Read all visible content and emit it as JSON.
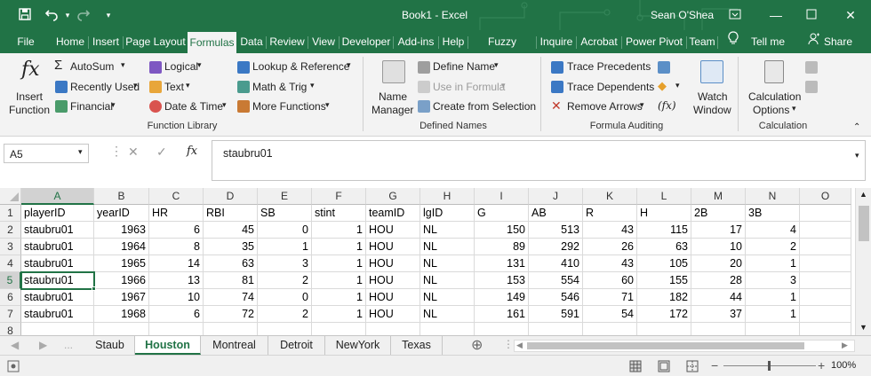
{
  "titlebar": {
    "doc_title": "Book1 - Excel",
    "user": "Sean O'Shea",
    "qat": {
      "save": "save-icon",
      "undo": "undo-icon",
      "redo": "redo-icon",
      "customize": "customize-icon"
    }
  },
  "tabs": [
    "File",
    "Home",
    "Insert",
    "Page Layout",
    "Formulas",
    "Data",
    "Review",
    "View",
    "Developer",
    "Add-ins",
    "Help",
    "Fuzzy Lookup",
    "Inquire",
    "Acrobat",
    "Power Pivot",
    "Team"
  ],
  "selected_tab": "Formulas",
  "tellme": "Tell me",
  "share": "Share",
  "ribbon": {
    "insert_function": [
      "Insert",
      "Function"
    ],
    "library": {
      "autosum": "AutoSum",
      "recent": "Recently Used",
      "financial": "Financial",
      "logical": "Logical",
      "text": "Text",
      "datetime": "Date & Time",
      "lookup": "Lookup & Reference",
      "math": "Math & Trig",
      "more": "More Functions",
      "group": "Function Library"
    },
    "names": {
      "manager": [
        "Name",
        "Manager"
      ],
      "define": "Define Name",
      "use": "Use in Formula",
      "create": "Create from Selection",
      "group": "Defined Names"
    },
    "auditing": {
      "precedents": "Trace Precedents",
      "dependents": "Trace Dependents",
      "remove": "Remove Arrows",
      "watch": [
        "Watch",
        "Window"
      ],
      "group": "Formula Auditing"
    },
    "calc": {
      "options": [
        "Calculation",
        "Options"
      ],
      "group": "Calculation"
    }
  },
  "namebox": "A5",
  "formula": "staubru01",
  "columns": [
    "A",
    "B",
    "C",
    "D",
    "E",
    "F",
    "G",
    "H",
    "I",
    "J",
    "K",
    "L",
    "M",
    "N",
    "O"
  ],
  "rows": [
    [
      "playerID",
      "yearID",
      "HR",
      "RBI",
      "SB",
      "stint",
      "teamID",
      "lgID",
      "G",
      "AB",
      "R",
      "H",
      "2B",
      "3B",
      ""
    ],
    [
      "staubru01",
      "1963",
      "6",
      "45",
      "0",
      "1",
      "HOU",
      "NL",
      "150",
      "513",
      "43",
      "115",
      "17",
      "4",
      ""
    ],
    [
      "staubru01",
      "1964",
      "8",
      "35",
      "1",
      "1",
      "HOU",
      "NL",
      "89",
      "292",
      "26",
      "63",
      "10",
      "2",
      ""
    ],
    [
      "staubru01",
      "1965",
      "14",
      "63",
      "3",
      "1",
      "HOU",
      "NL",
      "131",
      "410",
      "43",
      "105",
      "20",
      "1",
      ""
    ],
    [
      "staubru01",
      "1966",
      "13",
      "81",
      "2",
      "1",
      "HOU",
      "NL",
      "153",
      "554",
      "60",
      "155",
      "28",
      "3",
      ""
    ],
    [
      "staubru01",
      "1967",
      "10",
      "74",
      "0",
      "1",
      "HOU",
      "NL",
      "149",
      "546",
      "71",
      "182",
      "44",
      "1",
      ""
    ],
    [
      "staubru01",
      "1968",
      "6",
      "72",
      "2",
      "1",
      "HOU",
      "NL",
      "161",
      "591",
      "54",
      "172",
      "37",
      "1",
      ""
    ],
    [
      "",
      "",
      "",
      "",
      "",
      "",
      "",
      "",
      "",
      "",
      "",
      "",
      "",
      "",
      ""
    ]
  ],
  "row_numbers": [
    "1",
    "2",
    "3",
    "4",
    "5",
    "6",
    "7",
    "8"
  ],
  "sheets": [
    "Staub",
    "Houston",
    "Montreal",
    "Detroit",
    "NewYork",
    "Texas"
  ],
  "active_sheet": "Houston",
  "zoom": "100%"
}
